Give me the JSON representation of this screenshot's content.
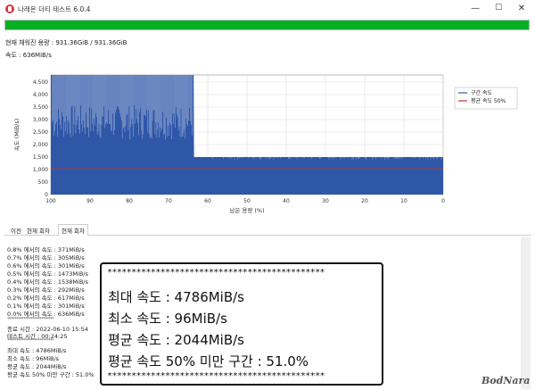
{
  "window": {
    "title": "나래온 더티 테스트 6.0.4",
    "min_glyph": "—",
    "max_glyph": "☐",
    "close_glyph": "✕"
  },
  "progress": {
    "fraction": 1.0,
    "color": "#06b025"
  },
  "status": {
    "capacity": "현재 채워진 용량 : 931.36GiB / 931.36GiB",
    "speed": "속도 : 636MiB/s"
  },
  "chart_data": {
    "type": "area",
    "title": "",
    "xlabel": "남은 용량 (%)",
    "ylabel": "속도 (MiB/s)",
    "xlim": [
      100,
      0
    ],
    "ylim": [
      0,
      4786
    ],
    "x_ticks": [
      "100",
      "90",
      "80",
      "70",
      "60",
      "50",
      "40",
      "30",
      "20",
      "10",
      "0"
    ],
    "y_ticks": [
      "0",
      "500",
      "1,000",
      "1,500",
      "2,000",
      "2,500",
      "3,000",
      "3,500",
      "4,000",
      "4,500"
    ],
    "grid": true,
    "legend_position": "top-right",
    "series": [
      {
        "name": "구간 속도",
        "color": "#2f57a8",
        "x": [
          100,
          99.5,
          95,
          90,
          85,
          80,
          75,
          70,
          65,
          63.6,
          63.5,
          60,
          50,
          40,
          30,
          20,
          10,
          0
        ],
        "y": [
          4786,
          4786,
          4786,
          4786,
          4786,
          4786,
          4786,
          4786,
          4786,
          4786,
          1500,
          1500,
          1500,
          1500,
          1500,
          1500,
          1500,
          1500
        ]
      },
      {
        "name": "평균 속도 50%",
        "color": "#c0392b",
        "x": [
          100,
          0
        ],
        "y": [
          1022,
          1022
        ]
      }
    ]
  },
  "tabs": [
    {
      "label": "이전",
      "active": false
    },
    {
      "label": "현재 회차",
      "active": true
    }
  ],
  "log": {
    "lines": [
      "0.8% 에서의 속도 : 371MiB/s",
      "0.7% 에서의 속도 : 305MiB/s",
      "0.6% 에서의 속도 : 301MiB/s",
      "0.5% 에서의 속도 : 1473MiB/s",
      "0.4% 에서의 속도 : 1538MiB/s",
      "0.3% 에서의 속도 : 292MiB/s",
      "0.2% 에서의 속도 : 617MiB/s",
      "0.1% 에서의 속도 : 301MiB/s",
      "0.0% 에서의 속도 : 636MiB/s"
    ],
    "separator": "**************************",
    "end_time": "종료 시간 : 2022-06-10 15:54",
    "test_time": "테스트 시간 : 00:24:25",
    "summary": [
      "최대 속도 : 4786MiB/s",
      "최소 속도 : 96MiB/s",
      "평균 속도 : 2044MiB/s",
      "평균 속도 50% 미만 구간 : 51.0%"
    ]
  },
  "overlay": {
    "stars": "*********************************************",
    "lines": [
      "최대 속도 : 4786MiB/s",
      "최소 속도 : 96MiB/s",
      "평균 속도 : 2044MiB/s",
      "평균 속도 50% 미만 구간 : 51.0%"
    ]
  },
  "watermark": "BodNara"
}
